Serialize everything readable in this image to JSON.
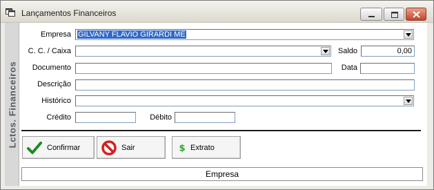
{
  "window": {
    "title": "Lançamentos Financeiros",
    "side_label": "Lctos. Financeiros"
  },
  "form": {
    "empresa": {
      "label": "Empresa",
      "value": "GILVANY FLAVIO GIRARDI ME"
    },
    "cc_caixa": {
      "label": "C. C. / Caixa",
      "value": ""
    },
    "saldo": {
      "label": "Saldo",
      "value": "0,00"
    },
    "documento": {
      "label": "Documento",
      "value": ""
    },
    "data": {
      "label": "Data",
      "value": ""
    },
    "descricao": {
      "label": "Descrição",
      "value": ""
    },
    "historico": {
      "label": "Histórico",
      "value": ""
    },
    "credito": {
      "label": "Crédito",
      "value": ""
    },
    "debito": {
      "label": "Débito",
      "value": ""
    }
  },
  "buttons": {
    "confirmar": "Confirmar",
    "sair": "Sair",
    "extrato": "Extrato"
  },
  "status_bar": {
    "text": "Empresa"
  },
  "colors": {
    "selection": "#3169c6",
    "confirm_icon": "#1e8a1e",
    "exit_icon": "#d42020",
    "extrato_icon": "#2ea82e",
    "close_button": "#c2452c"
  },
  "icons": {
    "app": "window-app-icon",
    "confirmar": "checkmark-icon",
    "sair": "prohibited-icon",
    "extrato": "dollar-sign-icon"
  }
}
